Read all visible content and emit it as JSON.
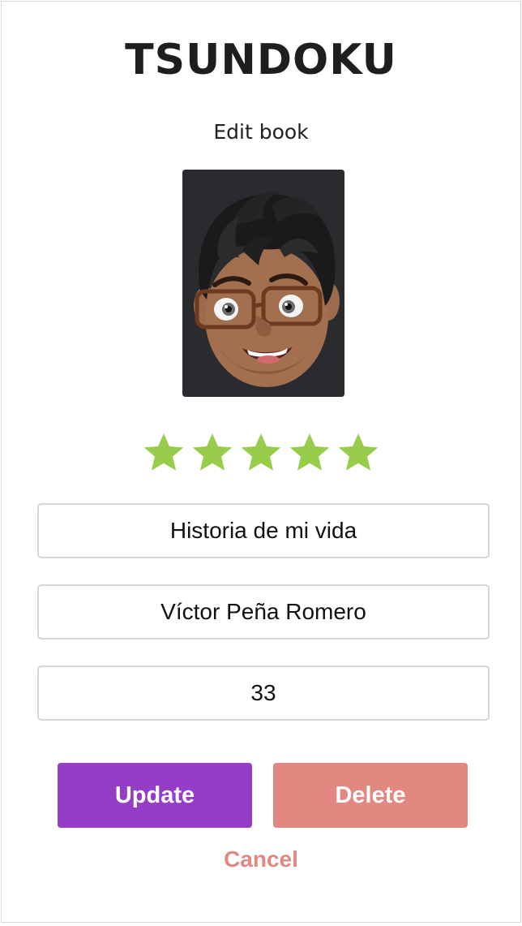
{
  "app": {
    "title": "TSUNDOKU",
    "subtitle": "Edit book"
  },
  "cover": {
    "image": "avatar-cover-image",
    "background_color": "#2a2b2f"
  },
  "rating": {
    "value": 5,
    "max": 5,
    "icon": "star-icon",
    "color": "#97cd4b"
  },
  "form": {
    "title_value": "Historia de mi vida",
    "author_value": "Víctor Peña Romero",
    "pages_value": "33"
  },
  "actions": {
    "update_label": "Update",
    "delete_label": "Delete",
    "cancel_label": "Cancel",
    "update_color": "#953dc7",
    "delete_color": "#e38781"
  }
}
